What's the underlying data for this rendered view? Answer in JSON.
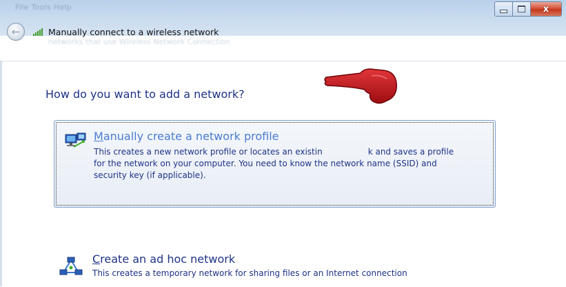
{
  "window": {
    "blurred_menu": "File   Tools   Help",
    "blurred_subtitle": "networks that use Wireless Network Connection",
    "caption": {
      "close_glyph": "x"
    }
  },
  "nav": {
    "back_glyph": "←",
    "title": "Manually connect to a wireless network"
  },
  "main": {
    "heading": "How do you want to add a network?",
    "options": [
      {
        "title_accel": "M",
        "title_rest": "anually create a network profile",
        "description": "This creates a new network profile or locates an existing network and saves a profile for the network on your computer. You need to know the network name (SSID) and security key (if applicable).",
        "desc_visible_part1": "This creates a new network profile or locates an existin",
        "desc_visible_part2": "k and saves a profile",
        "desc_line2": "for the network on your computer. You need to know the network name (SSID) and",
        "desc_line3": "security key (if applicable).",
        "state": "hover-focused"
      },
      {
        "title_accel": "C",
        "title_rest": "reate an ad hoc network",
        "description": "This creates a temporary network for sharing files or an Internet connection"
      }
    ]
  },
  "colors": {
    "link_hover": "#4a7bd0",
    "link": "#1e3287",
    "pointer": "#c0161a"
  }
}
